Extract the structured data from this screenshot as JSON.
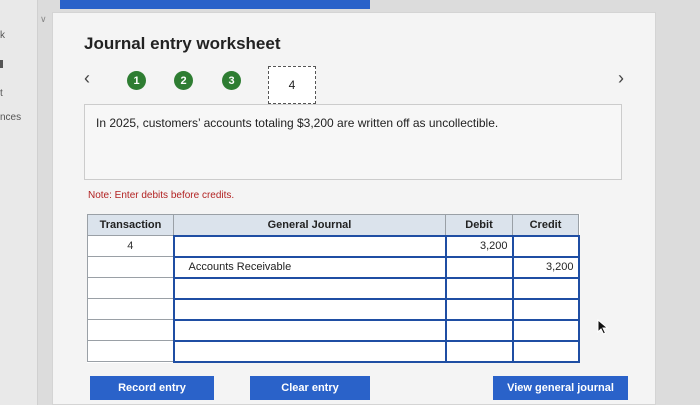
{
  "left_rail": {
    "labels": [
      "k",
      "t",
      "nces"
    ]
  },
  "worksheet": {
    "title": "Journal entry worksheet",
    "steps": [
      "1",
      "2",
      "3",
      "4"
    ],
    "current_step": "4",
    "description": "In 2025, customers’ accounts totaling $3,200 are written off as uncollectible.",
    "note": "Note: Enter debits before credits."
  },
  "table": {
    "headers": [
      "Transaction",
      "General Journal",
      "Debit",
      "Credit"
    ],
    "rows": [
      {
        "transaction": "4",
        "account": "",
        "debit": "3,200",
        "credit": ""
      },
      {
        "transaction": "",
        "account": "Accounts Receivable",
        "debit": "",
        "credit": "3,200"
      },
      {
        "transaction": "",
        "account": "",
        "debit": "",
        "credit": ""
      },
      {
        "transaction": "",
        "account": "",
        "debit": "",
        "credit": ""
      },
      {
        "transaction": "",
        "account": "",
        "debit": "",
        "credit": ""
      },
      {
        "transaction": "",
        "account": "",
        "debit": "",
        "credit": ""
      }
    ]
  },
  "buttons": {
    "record": "Record entry",
    "clear": "Clear entry",
    "view": "View general journal"
  },
  "colors": {
    "accent": "#2a62c9",
    "step_complete": "#2e7d32",
    "note": "#b22222",
    "header_bg": "#dbe3ec"
  },
  "icons": {
    "prev": "chevron-left-icon",
    "next": "chevron-right-icon",
    "cursor": "mouse-pointer-icon"
  }
}
